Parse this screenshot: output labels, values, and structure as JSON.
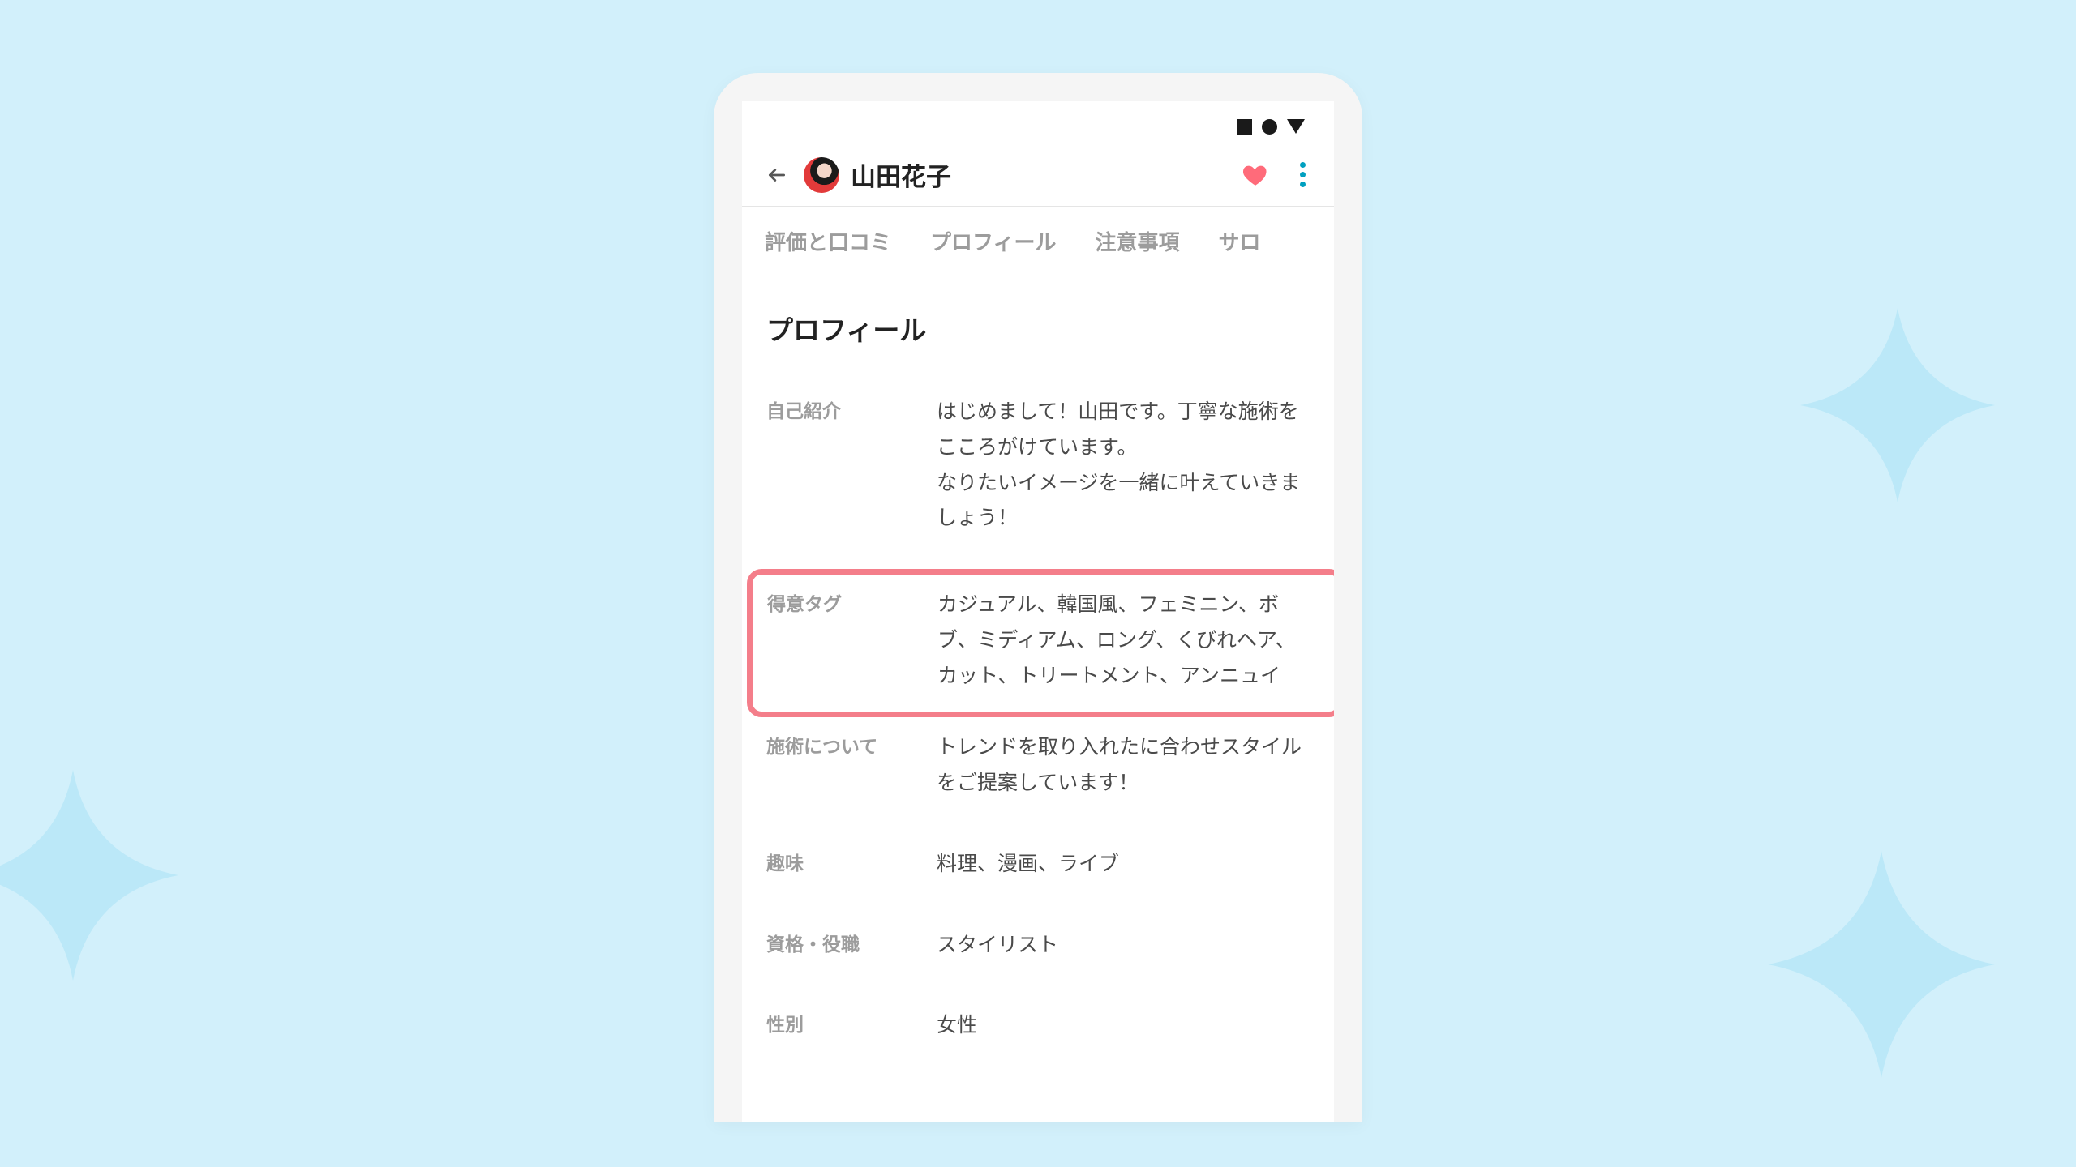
{
  "header": {
    "name": "山田花子"
  },
  "tabs": {
    "reviews": "評価と口コミ",
    "profile": "プロフィール",
    "notice": "注意事項",
    "salon": "サロ"
  },
  "section_title": "プロフィール",
  "fields": {
    "intro": {
      "label": "自己紹介",
      "value": "はじめまして！山田です。丁寧な施術をこころがけています。\nなりたいイメージを一緒に叶えていきましょう！"
    },
    "tags": {
      "label": "得意タグ",
      "value": "カジュアル、韓国風、フェミニン、ボブ、ミディアム、ロング、くびれヘア、カット、トリートメント、アンニュイ"
    },
    "treatment": {
      "label": "施術について",
      "value": "トレンドを取り入れたに合わせスタイルをご提案しています！"
    },
    "hobby": {
      "label": "趣味",
      "value": "料理、漫画、ライブ"
    },
    "role": {
      "label": "資格・役職",
      "value": "スタイリスト"
    },
    "gender": {
      "label": "性別",
      "value": "女性"
    }
  },
  "colors": {
    "accent_heart": "#ff6b7a",
    "accent_more": "#00a0c0",
    "highlight": "#f47e8a",
    "bg": "#d2f0fb"
  }
}
